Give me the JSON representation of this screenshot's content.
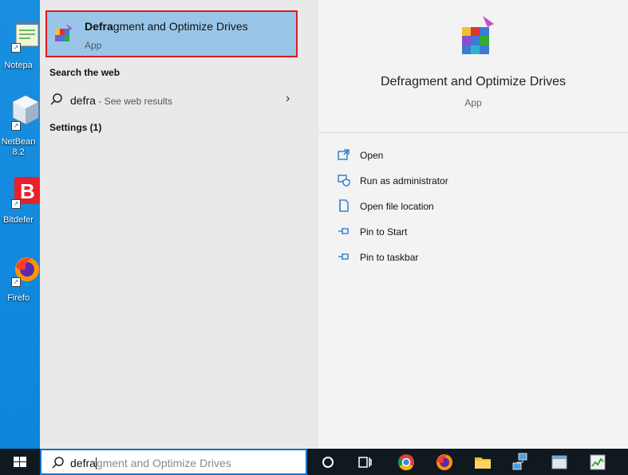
{
  "desktop": {
    "icons": [
      {
        "label": "Notepa"
      },
      {
        "label": "NetBean",
        "label2": "8.2"
      },
      {
        "label": "Bitdefer"
      },
      {
        "label": "Firefo"
      }
    ]
  },
  "best_match": {
    "title_bold": "Defra",
    "title_rest": "gment and Optimize Drives",
    "subtitle": "App"
  },
  "search_web": {
    "heading": "Search the web",
    "query": "defra",
    "hint": " - See web results"
  },
  "settings": {
    "heading": "Settings (1)"
  },
  "details": {
    "title": "Defragment and Optimize Drives",
    "subtitle": "App",
    "actions": [
      {
        "label": "Open",
        "icon": "open-icon"
      },
      {
        "label": "Run as administrator",
        "icon": "shield-icon"
      },
      {
        "label": "Open file location",
        "icon": "file-location-icon"
      },
      {
        "label": "Pin to Start",
        "icon": "pin-icon"
      },
      {
        "label": "Pin to taskbar",
        "icon": "pin-icon"
      }
    ]
  },
  "taskbar": {
    "search_typed": "defra",
    "search_ghost": "gment and Optimize Drives",
    "icons": [
      "cortana-icon",
      "task-view-icon",
      "chrome-icon",
      "firefox-icon",
      "file-explorer-icon",
      "network-icon",
      "notepad-icon",
      "task-manager-icon"
    ]
  },
  "colors": {
    "accent": "#1673c8",
    "highlight": "#99c6e8",
    "selection_border": "#e01a22"
  }
}
